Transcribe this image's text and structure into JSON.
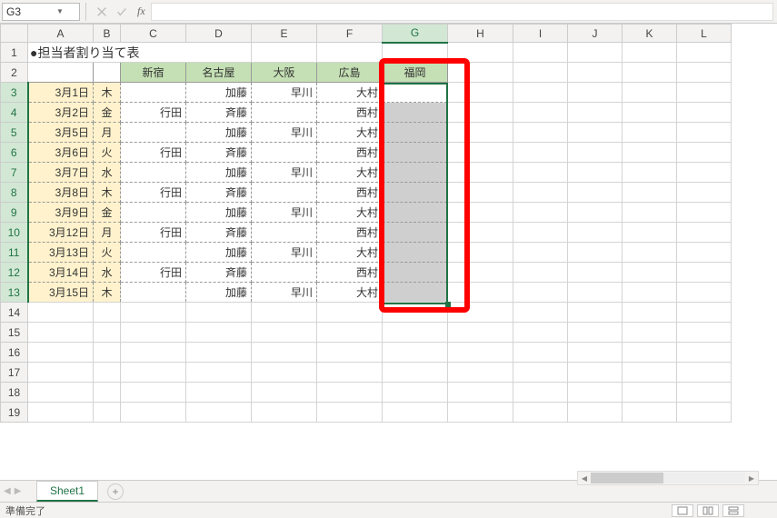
{
  "namebox": {
    "ref": "G3"
  },
  "fx": {
    "label": "fx"
  },
  "title": "●担当者割り当て表",
  "headers": {
    "c": "新宿",
    "d": "名古屋",
    "e": "大阪",
    "f": "広島",
    "g": "福岡"
  },
  "rows": [
    {
      "date": "3月1日",
      "dow": "木",
      "c": "",
      "d": "加藤",
      "e": "早川",
      "f": "大村"
    },
    {
      "date": "3月2日",
      "dow": "金",
      "c": "行田",
      "d": "斉藤",
      "e": "",
      "f": "西村"
    },
    {
      "date": "3月5日",
      "dow": "月",
      "c": "",
      "d": "加藤",
      "e": "早川",
      "f": "大村"
    },
    {
      "date": "3月6日",
      "dow": "火",
      "c": "行田",
      "d": "斉藤",
      "e": "",
      "f": "西村"
    },
    {
      "date": "3月7日",
      "dow": "水",
      "c": "",
      "d": "加藤",
      "e": "早川",
      "f": "大村"
    },
    {
      "date": "3月8日",
      "dow": "木",
      "c": "行田",
      "d": "斉藤",
      "e": "",
      "f": "西村"
    },
    {
      "date": "3月9日",
      "dow": "金",
      "c": "",
      "d": "加藤",
      "e": "早川",
      "f": "大村"
    },
    {
      "date": "3月12日",
      "dow": "月",
      "c": "行田",
      "d": "斉藤",
      "e": "",
      "f": "西村"
    },
    {
      "date": "3月13日",
      "dow": "火",
      "c": "",
      "d": "加藤",
      "e": "早川",
      "f": "大村"
    },
    {
      "date": "3月14日",
      "dow": "水",
      "c": "行田",
      "d": "斉藤",
      "e": "",
      "f": "西村"
    },
    {
      "date": "3月15日",
      "dow": "木",
      "c": "",
      "d": "加藤",
      "e": "早川",
      "f": "大村"
    }
  ],
  "sheet_tab": "Sheet1",
  "status": "準備完了",
  "columns": [
    "A",
    "B",
    "C",
    "D",
    "E",
    "F",
    "G",
    "H",
    "I",
    "J",
    "K",
    "L"
  ],
  "colwidths": {
    "rowhdr": 30,
    "A": 72,
    "B": 30,
    "C": 72,
    "D": 72,
    "E": 72,
    "F": 72,
    "G": 72,
    "H": 72,
    "I": 60,
    "J": 60,
    "K": 60,
    "L": 60
  }
}
